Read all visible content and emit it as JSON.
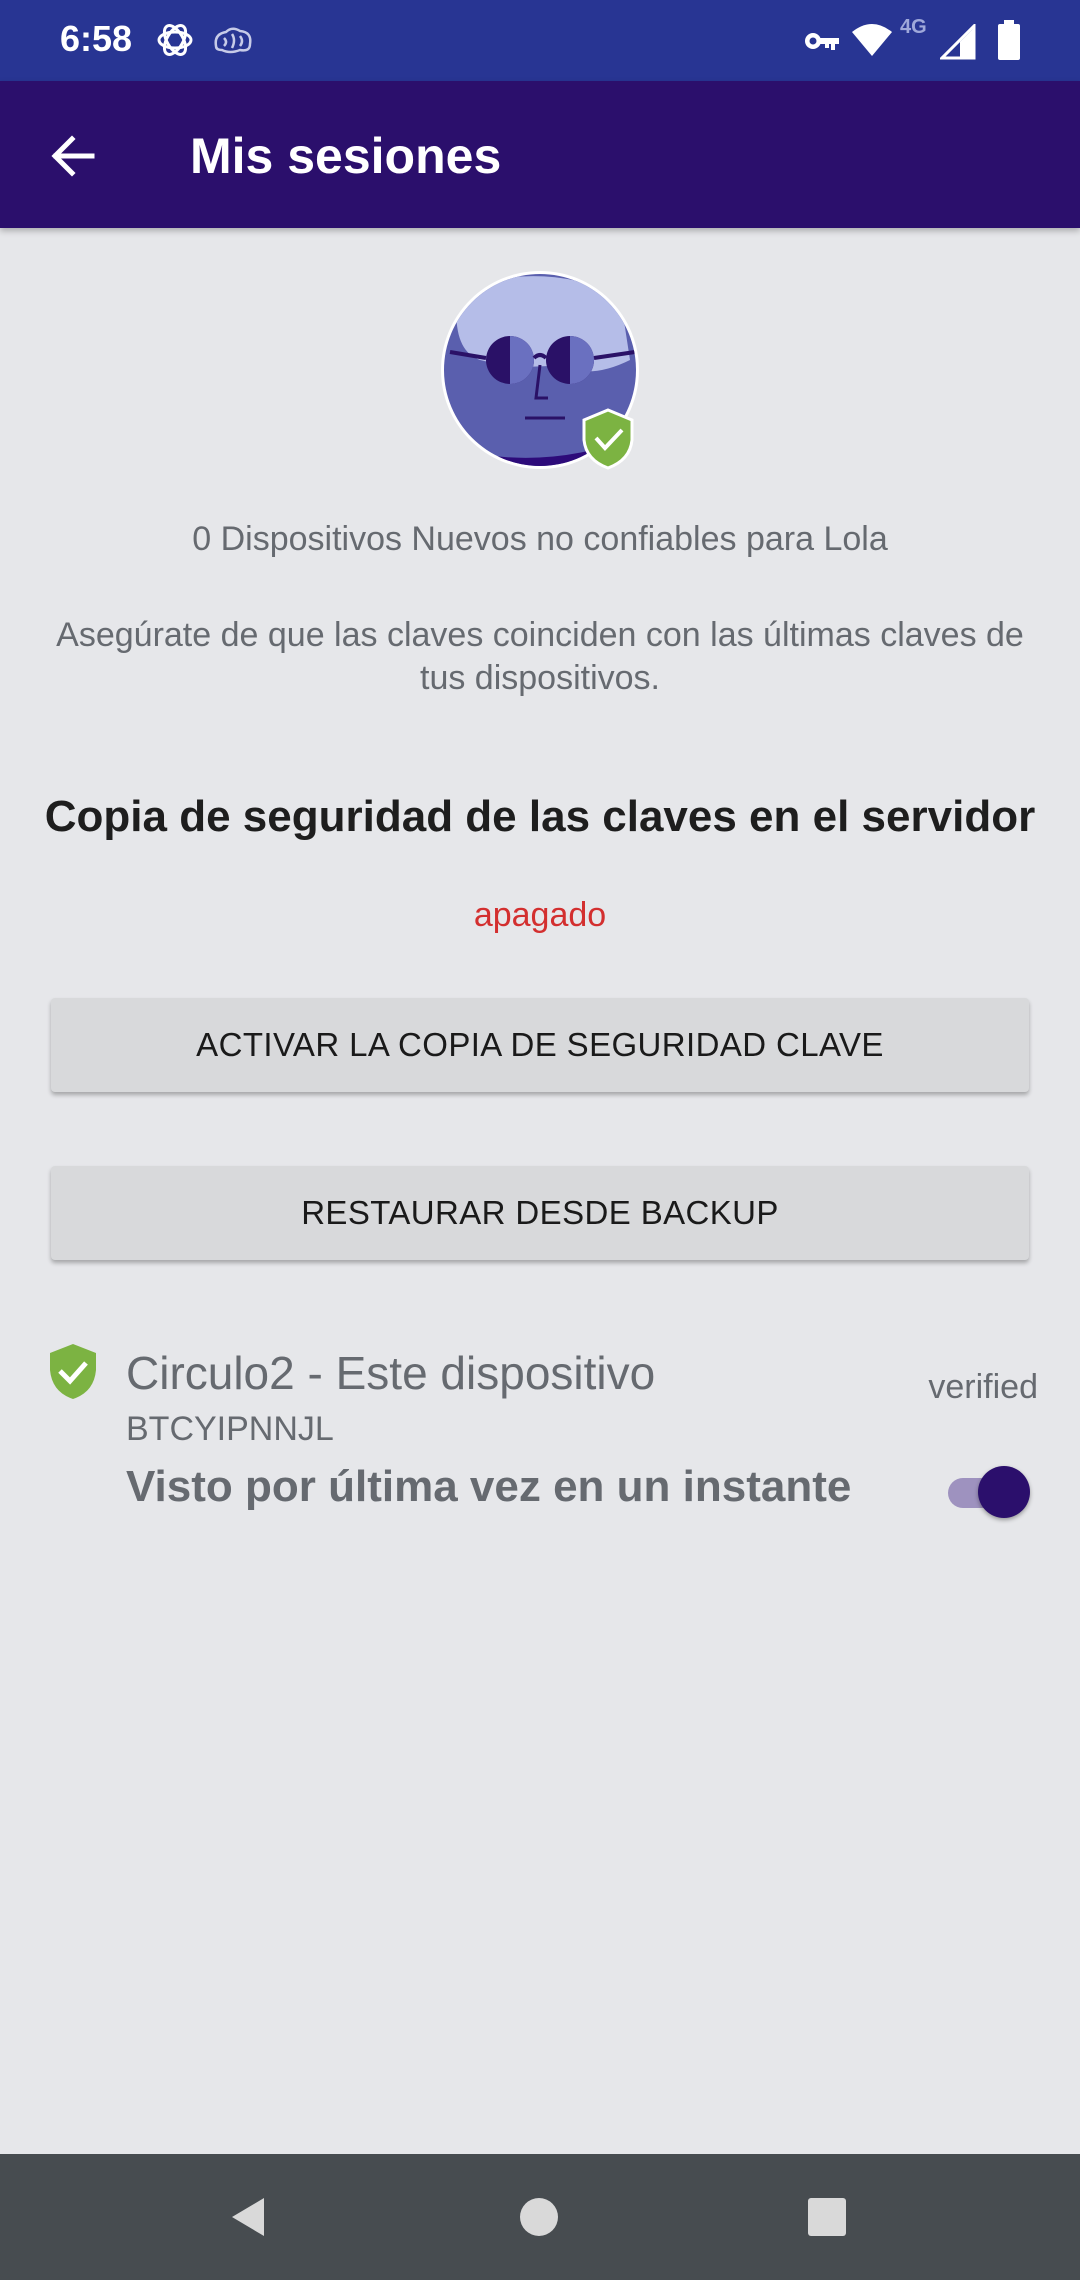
{
  "status_bar": {
    "time": "6:58",
    "network_label": "4G",
    "icons": [
      "openai-icon",
      "brain-icon",
      "vpn-key-icon",
      "wifi-icon",
      "signal-icon",
      "battery-icon"
    ]
  },
  "app_bar": {
    "title": "Mis sesiones",
    "back_icon": "arrow-back-icon",
    "background": "#2b0f6c"
  },
  "summary": {
    "untrusted_devices": "0 Dispositivos Nuevos no confiables para Lola",
    "keys_hint": "Asegúrate de que las claves coinciden con las últimas claves de tus dispositivos."
  },
  "backup": {
    "heading": "Copia de seguridad de las claves en el servidor",
    "status": "apagado",
    "status_color": "#d32f2f",
    "activate_button": "ACTIVAR LA COPIA DE SEGURIDAD CLAVE",
    "restore_button": "RESTAURAR DESDE BACKUP"
  },
  "device": {
    "name": "Circulo2 - Este dispositivo",
    "id": "BTCYIPNNJL",
    "last_seen": "Visto por última vez en un instante",
    "status": "verified",
    "toggle_on": true,
    "shield_color": "#7cb342"
  }
}
